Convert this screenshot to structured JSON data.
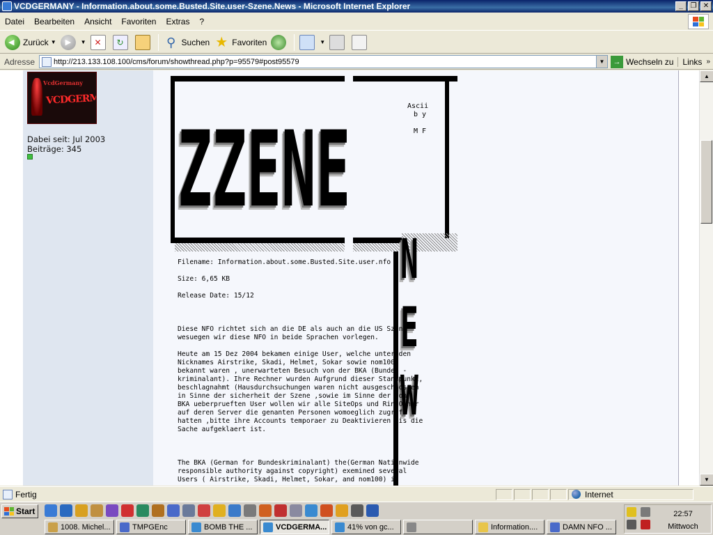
{
  "window": {
    "title": "VCDGERMANY - Information.about.some.Busted.Site.user-Szene.News - Microsoft Internet Explorer",
    "controls": [
      "_",
      "❐",
      "✕"
    ]
  },
  "menu": [
    "Datei",
    "Bearbeiten",
    "Ansicht",
    "Favoriten",
    "Extras",
    "?"
  ],
  "toolbar": {
    "back_label": "Zurück",
    "search_label": "Suchen",
    "favorites_label": "Favoriten"
  },
  "address": {
    "label": "Adresse",
    "url": "http://213.133.108.100/cms/forum/showthread.php?p=95579#post95579",
    "go_label": "Wechseln zu",
    "links_label": "Links"
  },
  "post": {
    "member_since": "Dabei seit: Jul 2003",
    "posts": "Beiträge: 345",
    "avatar_top": "VcdGermany",
    "avatar_main": "VCDGERMANY"
  },
  "nfo": {
    "big_word": "ZZENE",
    "credits": "Ascii\n b y\n\n M F",
    "news_letters": [
      "N",
      "E",
      "W"
    ],
    "body": "Filename: Information.about.some.Busted.Site.user.nfo\n\nSize: 6,65 KB\n\nRelease Date: 15/12\n\n\n\nDiese NFO richtet sich an die DE als auch an die US Szene\nwesuegen wir diese NFO in beide Sprachen vorlegen.\n\nHeute am 15 Dez 2004 bekamen einige User, welche unter den\nNicknames Airstrike, Skadi, Helmet, Sokar sowie nom100\nbekannt waren , unerwarteten Besuch von der BKA (Bundes -\nkriminalant). Ihre Rechner wurden Aufgrund dieser Standpunkt,\nbeschlagnahmt (Hausdurchsuchungen waren nicht ausgeschlossen\nin Sinne der sicherheit der Szene ,sowie im Sinne der von\nBKA ueberprueften User wollen wir alle SiteOps und RingOwner\nauf deren Server die genanten Personen womoeglich zugriff\nhatten ,bitte ihre Accounts temporaer zu Deaktivieren bis die\nSache aufgeklaert ist.\n\n\n\nThe BKA (German for Bundeskriminalant) the(German Nationwide\nresponsible authority against copyright) exemined several\nUsers ( Airstrike, Skadi, Helmet, Sokar, and nom100) in"
  },
  "status": {
    "text": "Fertig",
    "zone": "Internet"
  },
  "taskbar": {
    "start_label": "Start",
    "tasks": [
      {
        "label": "1008. Michel...",
        "color": "#c9a04a"
      },
      {
        "label": "TMPGEnc",
        "color": "#4a6ac9"
      },
      {
        "label": "BOMB THE ...",
        "color": "#3a8ad0"
      },
      {
        "label": "VCDGERMA...",
        "color": "#3a8ad0",
        "active": true
      },
      {
        "label": "41% von gc...",
        "color": "#3a8ad0"
      },
      {
        "label": "",
        "color": "#888888"
      },
      {
        "label": "Information....",
        "color": "#e8c54a"
      },
      {
        "label": "DAMN NFO ...",
        "color": "#4a6ac9"
      }
    ],
    "clock": "22:57",
    "day": "Mittwoch"
  }
}
